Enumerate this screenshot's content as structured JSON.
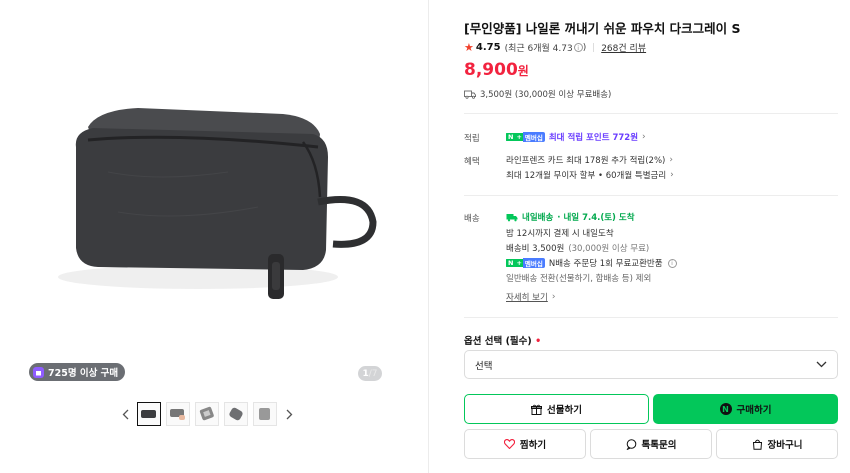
{
  "gallery": {
    "buyers_badge": "725명 이상 구매",
    "pager_current": "1",
    "pager_total": "/7",
    "thumbnail_count": 5
  },
  "product": {
    "title": "[무인양품] 나일론 꺼내기 쉬운 파우치 다크그레이 S",
    "rating": "4.75",
    "rating_recent": "(최근 6개월 4.73",
    "rating_recent_close": ")",
    "review_count": "268건 리뷰",
    "price": "8,900",
    "price_unit": "원",
    "shipping_fee_line": "3,500원 (30,000원 이상 무료배송)"
  },
  "benefits": {
    "points_label": "적립",
    "points_chip_n": "N",
    "points_chip_plus": "+",
    "points_chip_m": "멤버십",
    "points_text": "최대 적립 포인트 772원",
    "benefit_label": "혜택",
    "benefit_line1": "라인프렌즈 카드 최대 178원 추가 적립(2%)",
    "benefit_line2": "최대 12개월 무이자 할부 • 60개월 특별금리"
  },
  "delivery": {
    "label": "배송",
    "badge": "내일배송",
    "eta": "· 내일 7.4.(토) 도착",
    "cutoff": "밤 12시까지 결제 시 내일도착",
    "fee": "배송비 3,500원",
    "fee_note": "(30,000원 이상 무료)",
    "return_text": "N배송 주문당 1회 무료교환반품",
    "exclude": "일반배송 전환(선물하기, 합배송 등) 제외",
    "more": "자세히 보기"
  },
  "options": {
    "label": "옵션 선택 (필수)",
    "required_mark": "•",
    "placeholder": "선택"
  },
  "buttons": {
    "gift": "선물하기",
    "buy": "구매하기",
    "buy_icon": "N",
    "zzim": "찜하기",
    "talk": "톡톡문의",
    "cart": "장바구니"
  },
  "colors": {
    "brand_green": "#03c75a",
    "price_red": "#f2233f",
    "star_red": "#f1402a",
    "membership_purple": "#6a3dff"
  },
  "icons": [
    "star-icon",
    "info-icon",
    "truck-icon",
    "chevron-right-icon",
    "chevron-down-icon",
    "gift-icon",
    "heart-icon",
    "chat-icon",
    "cart-icon",
    "chevron-left-icon"
  ]
}
